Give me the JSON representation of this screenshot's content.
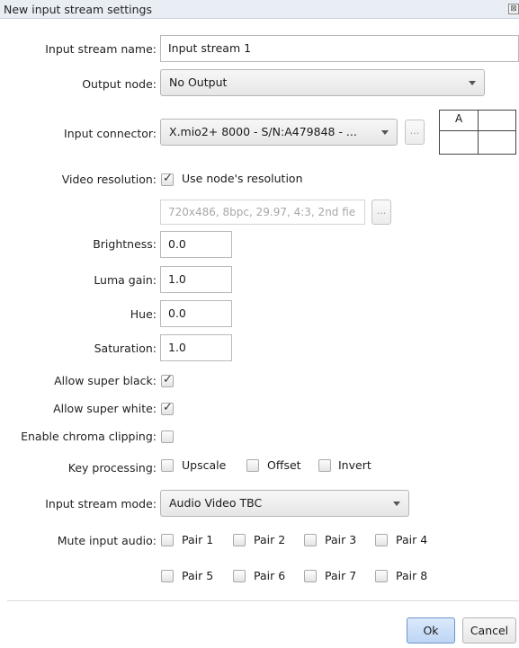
{
  "window": {
    "title": "New input stream settings",
    "close_glyph": "⊠"
  },
  "form": {
    "input_stream_name": {
      "label": "Input stream name:",
      "value": "Input stream 1"
    },
    "output_node": {
      "label": "Output node:",
      "value": "No Output"
    },
    "input_connector": {
      "label": "Input connector:",
      "value": "X.mio2+ 8000 - S/N:A479848 - ...",
      "browse": "...",
      "grid_cell_a": "A"
    },
    "video_resolution": {
      "label": "Video resolution:",
      "use_nodes_label": "Use node's resolution",
      "use_nodes_checked": true,
      "format_value": "720x486, 8bpc, 29.97, 4:3, 2nd fie",
      "browse": "..."
    },
    "brightness": {
      "label": "Brightness:",
      "value": "0.0"
    },
    "luma_gain": {
      "label": "Luma gain:",
      "value": "1.0"
    },
    "hue": {
      "label": "Hue:",
      "value": "0.0"
    },
    "saturation": {
      "label": "Saturation:",
      "value": "1.0"
    },
    "allow_super_black": {
      "label": "Allow super black:",
      "checked": true
    },
    "allow_super_white": {
      "label": "Allow super white:",
      "checked": true
    },
    "enable_chroma_clipping": {
      "label": "Enable chroma clipping:",
      "checked": false
    },
    "key_processing": {
      "label": "Key processing:",
      "options": [
        "Upscale",
        "Offset",
        "Invert"
      ]
    },
    "input_stream_mode": {
      "label": "Input stream mode:",
      "value": "Audio Video TBC"
    },
    "mute_input_audio": {
      "label": "Mute input audio:",
      "pairs": [
        "Pair 1",
        "Pair 2",
        "Pair 3",
        "Pair 4",
        "Pair 5",
        "Pair 6",
        "Pair 7",
        "Pair 8"
      ]
    }
  },
  "buttons": {
    "ok": "Ok",
    "cancel": "Cancel"
  },
  "colors": {
    "ok_accent": "#bdd5f4",
    "title_bar": "#e9eef5"
  }
}
